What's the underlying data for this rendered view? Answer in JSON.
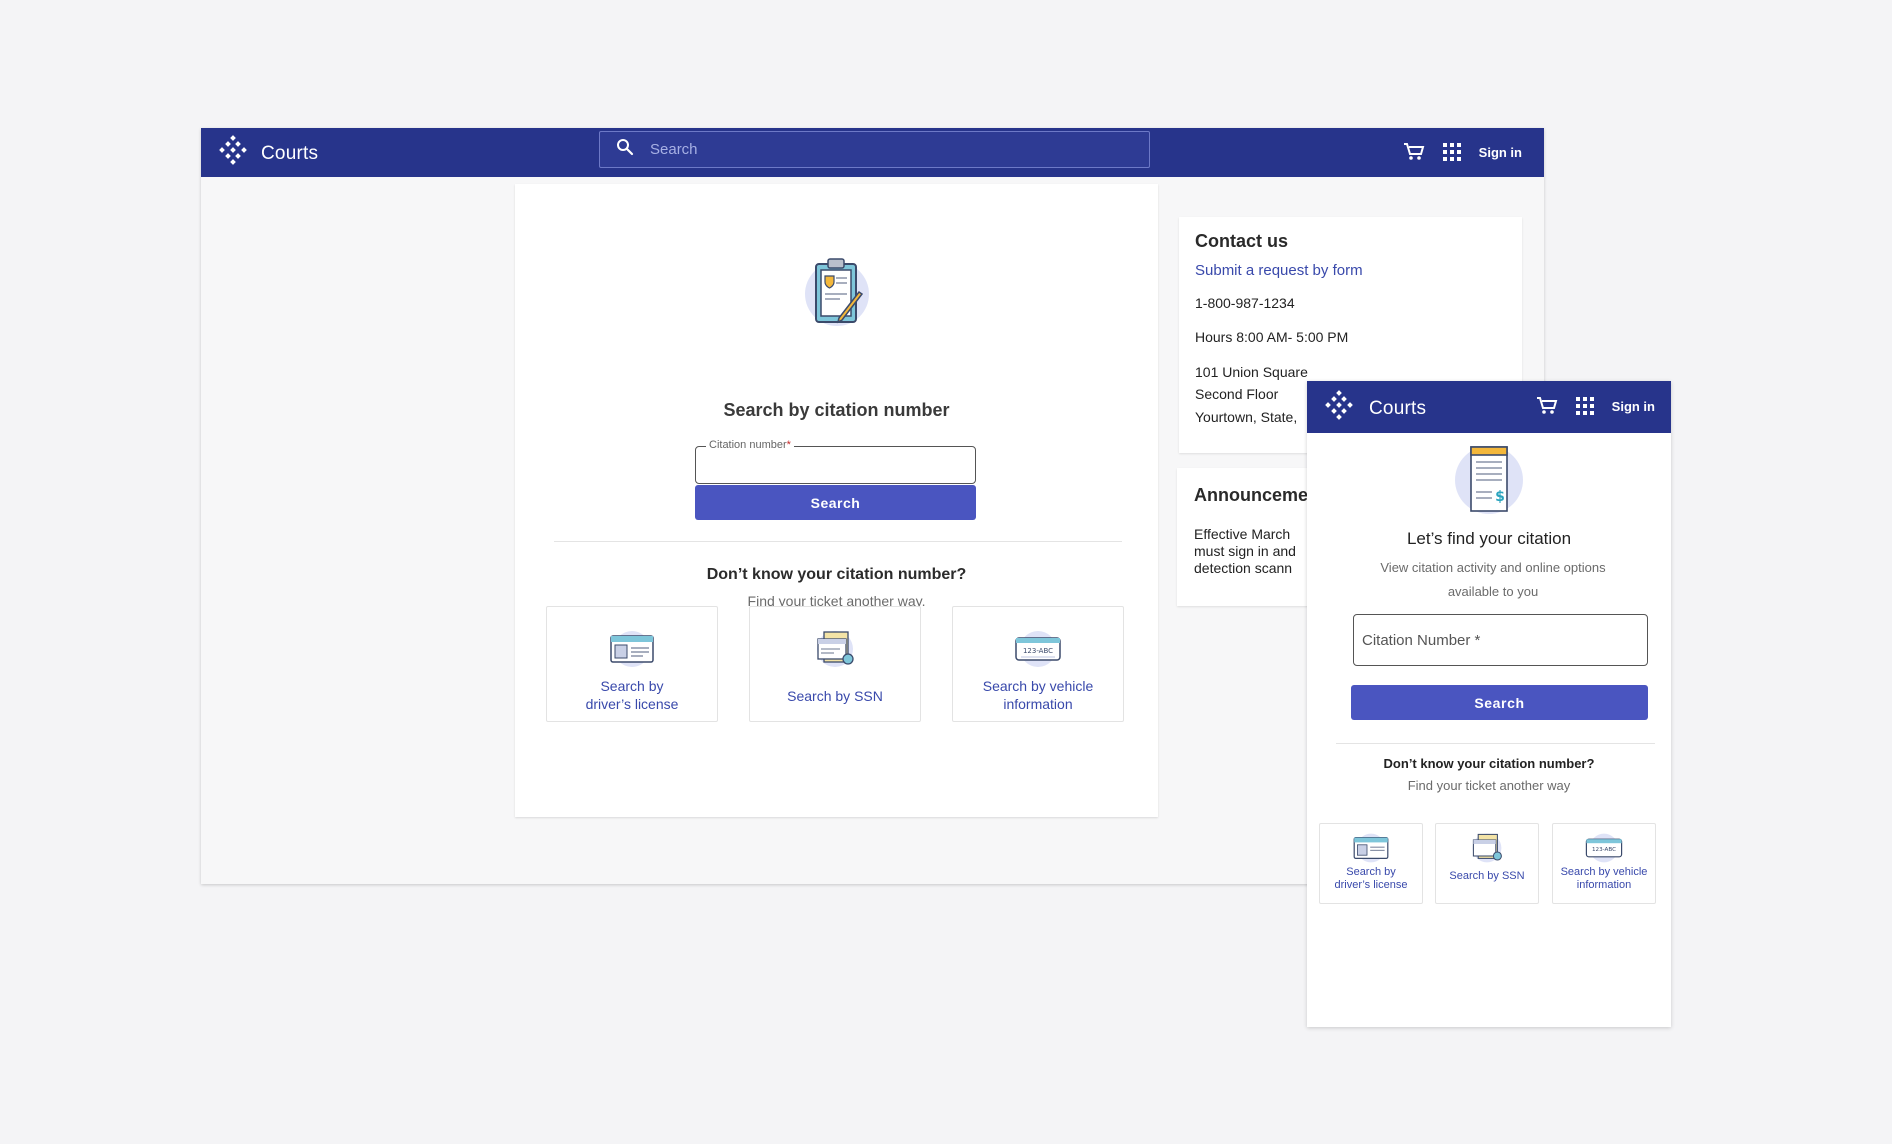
{
  "app": {
    "name": "Courts"
  },
  "header": {
    "search_placeholder": "Search",
    "signin": "Sign in"
  },
  "main": {
    "title": "Search by citation number",
    "field_label": "Citation number",
    "field_required": "*",
    "search_button": "Search",
    "question": "Don’t know your citation number?",
    "question_sub": "Find your ticket another way.",
    "options": [
      {
        "line1": "Search by",
        "line2": "driver’s license"
      },
      {
        "line1": "Search by SSN",
        "line2": ""
      },
      {
        "line1": "Search by vehicle",
        "line2": "information"
      }
    ]
  },
  "contact": {
    "title": "Contact us",
    "link": "Submit a request by form",
    "phone": "1-800-987-1234",
    "hours": "Hours 8:00 AM- 5:00 PM",
    "address1": "101 Union Square",
    "address2": "Second Floor",
    "address3": "Yourtown, State,"
  },
  "announcement": {
    "title": "Announceme",
    "line1": "Effective March",
    "line2": "must sign in and",
    "line3": "detection scann"
  },
  "mobile": {
    "title": "Let’s find your citation",
    "subtitle": "View citation activity and online options available to you",
    "field_placeholder": "Citation Number *",
    "search_button": "Search",
    "question": "Don’t know your citation number?",
    "question_sub": "Find your ticket another way",
    "options": [
      {
        "line1": "Search by",
        "line2": "driver’s license"
      },
      {
        "line1": "Search by SSN",
        "line2": ""
      },
      {
        "line1": "Search by vehicle",
        "line2": "information"
      }
    ],
    "plate_text": "123-ABC"
  },
  "colors": {
    "brand": "#27348b",
    "primary_button": "#4a55c0",
    "link": "#3949ab"
  },
  "icons": [
    "logo-icon",
    "search-icon",
    "cart-icon",
    "apps-grid-icon",
    "clipboard-icon",
    "license-card-icon",
    "ssn-card-icon",
    "vehicle-plate-icon",
    "invoice-icon"
  ]
}
